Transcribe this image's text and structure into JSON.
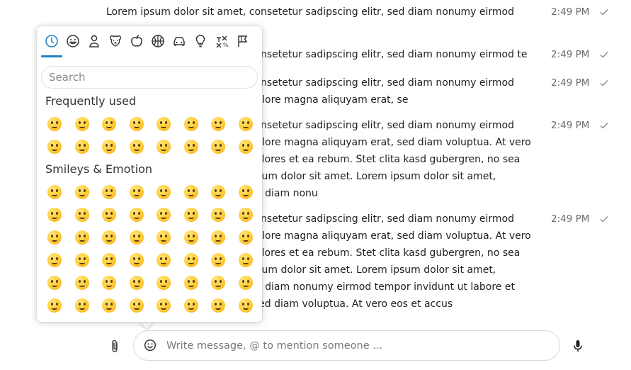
{
  "messages": [
    {
      "text": "Lorem ipsum dolor sit amet, consetetur sadipscing elitr, sed diam nonumy eirmod",
      "time": "2:49 PM"
    },
    {
      "text": "Lorem ipsum dolor sit amet, consetetur sadipscing elitr, sed diam nonumy eirmod te",
      "time": "2:49 PM"
    },
    {
      "text": "Lorem ipsum dolor sit amet, consetetur sadipscing elitr, sed diam nonumy eirmod\ntempor invidunt ut labore et dolore magna aliquyam erat, se",
      "time": "2:49 PM"
    },
    {
      "text": "Lorem ipsum dolor sit amet, consetetur sadipscing elitr, sed diam nonumy eirmod\ntempor invidunt ut labore et dolore magna aliquyam erat, sed diam voluptua. At vero\neos et accusam et justo duo dolores et ea rebum. Stet clita kasd gubergren, no sea\ntakimata sanctus est Lorem ipsum dolor sit amet. Lorem ipsum dolor sit amet,\nconsetetur sadipscing elitr, sed diam nonu",
      "time": "2:49 PM"
    },
    {
      "text": "Lorem ipsum dolor sit amet, consetetur sadipscing elitr, sed diam nonumy eirmod\ntempor invidunt ut labore et dolore magna aliquyam erat, sed diam voluptua. At vero\neos et accusam et justo duo dolores et ea rebum. Stet clita kasd gubergren, no sea\ntakimata sanctus est Lorem ipsum dolor sit amet. Lorem ipsum dolor sit amet,\nconsetetur sadipscing elitr, sed diam nonumy eirmod tempor invidunt ut labore et\ndolore magna aliquyam erat, sed diam voluptua. At vero eos et accus",
      "time": "2:49 PM"
    }
  ],
  "emoji_picker": {
    "categories": [
      {
        "name": "recent-category-icon",
        "active": true
      },
      {
        "name": "smileys-category-icon"
      },
      {
        "name": "people-category-icon"
      },
      {
        "name": "animals-category-icon"
      },
      {
        "name": "food-category-icon"
      },
      {
        "name": "activities-category-icon"
      },
      {
        "name": "travel-category-icon"
      },
      {
        "name": "objects-category-icon"
      },
      {
        "name": "symbols-category-icon"
      },
      {
        "name": "flags-category-icon"
      }
    ],
    "search_placeholder": "Search",
    "sections": [
      {
        "title": "Frequently used",
        "emojis": [
          "👍",
          "😀",
          "😘",
          "😍",
          "😆",
          "😜",
          "😅",
          "😂",
          "😱",
          "😞",
          "😒",
          "😩",
          "😭",
          "😎",
          "❤️",
          "💩"
        ]
      },
      {
        "title": "Smileys & Emotion",
        "emojis": [
          "😀",
          "😃",
          "😄",
          "😁",
          "😆",
          "😅",
          "🤣",
          "😂",
          "🙂",
          "🙃",
          "😉",
          "😊",
          "😇",
          "🥰",
          "😍",
          "🤩",
          "😘",
          "😗",
          "☺️",
          "😚",
          "😙",
          "😋",
          "😛",
          "😜",
          "🤪",
          "😝",
          "🤑",
          "🤗",
          "🤭",
          "🤫",
          "🤔",
          "🤐",
          "🤨",
          "😐",
          "😑",
          "😶",
          "😏",
          "😒",
          "🙄",
          "😬",
          "🤥",
          "😌",
          "😔",
          "😪",
          "🤤",
          "😴",
          "😷",
          "🤒"
        ]
      }
    ],
    "colors": {
      "accent": "#1c84c8"
    }
  },
  "composer": {
    "placeholder": "Write message, @ to mention someone ...",
    "attach_icon": "paperclip-icon",
    "emoji_icon": "smiley-icon",
    "mic_icon": "microphone-icon"
  }
}
